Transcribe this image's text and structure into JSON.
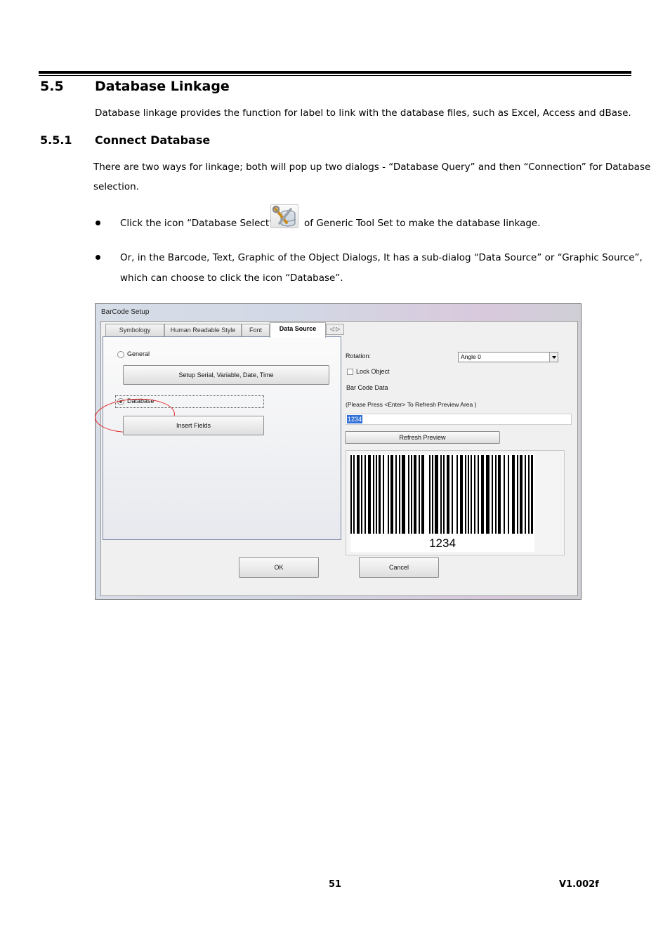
{
  "section": {
    "number": "5.5",
    "title": "Database Linkage",
    "intro": "Database linkage provides the function for label to link with the database files, such as Excel, Access and dBase."
  },
  "subsection": {
    "number": "5.5.1",
    "title": "Connect Database",
    "paragraph_line1": "There are two ways for linkage; both will pop up two dialogs - “Database Query” and then “Connection” for Database",
    "paragraph_line2": "selection.",
    "bullet1_before": "Click the icon “Database Select”",
    "bullet1_after": "of Generic Tool Set to make the database linkage.",
    "bullet2_line1": "Or, in the Barcode, Text, Graphic of the Object Dialogs, It has a sub-dialog “Data Source” or “Graphic Source”,",
    "bullet2_line2": "which can choose to click the icon “Database”.",
    "icon": "database-select-tools-icon"
  },
  "dialog": {
    "title": "BarCode Setup",
    "tabs": [
      "Symbology",
      "Human Readable Style",
      "Font",
      "Data Source"
    ],
    "tab_scroll": "◁ ▷",
    "general_label": "General",
    "setup_button": "Setup Serial, Variable, Date, Time",
    "database_label": "Database",
    "insert_fields_button": "Insert Fields",
    "rotation_label": "Rotation:",
    "rotation_value": "Angle 0",
    "lock_object_label": "Lock Object",
    "barcode_data_label": "Bar Code Data",
    "hint": "(Please  Press <Enter> To Refresh Preview Area )",
    "data_value": "1234",
    "refresh_button": "Refresh Preview",
    "preview_text": "1234",
    "ok_button": "OK",
    "cancel_button": "Cancel",
    "highlight_color": "#e02020"
  },
  "footer": {
    "page": "51",
    "version": "V1.002f"
  }
}
